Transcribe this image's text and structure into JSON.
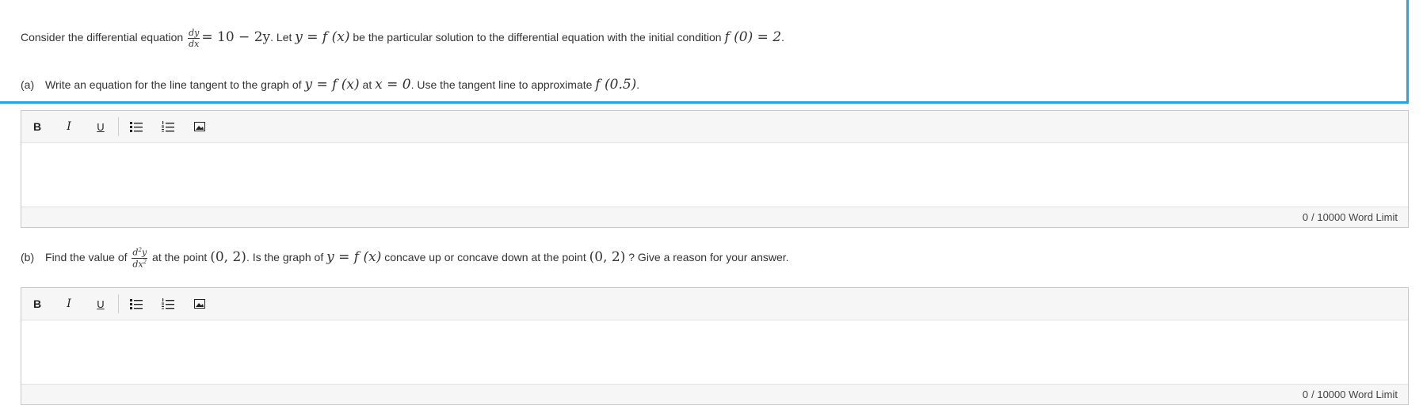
{
  "question": {
    "intro": {
      "text1": "Consider the differential equation",
      "frac_num": "dy",
      "frac_den": "dx",
      "eq": "= 10 − 2y",
      "text2": ". Let",
      "y_eq_f": "y = f (x)",
      "text3": "be the particular solution to the differential equation with the initial condition",
      "initial": "f (0) = 2",
      "text4": "."
    },
    "part_a": {
      "label": "(a)",
      "text1": "Write an equation for the line tangent to the graph of",
      "y_eq_f": "y = f (x)",
      "text2": "at",
      "x_eq": "x = 0",
      "text3": ". Use the tangent line to approximate",
      "approx": "f (0.5)",
      "text4": "."
    },
    "part_b": {
      "label": "(b)",
      "text1": "Find the value of",
      "frac_num_base": "d",
      "frac_num_sup": "2",
      "frac_num_tail": "y",
      "frac_den_base": "dx",
      "frac_den_sup": "2",
      "text2": "at the point",
      "point1": "(0, 2)",
      "text3": ". Is the graph of",
      "y_eq_f": "y = f (x)",
      "text4": "concave up or concave down at the point",
      "point2": "(0, 2)",
      "text5": "? Give a reason for your answer."
    }
  },
  "editor_toolbar": {
    "bold_label": "B",
    "italic_label": "I",
    "underline_label": "U",
    "icons": [
      "bold-icon",
      "italic-icon",
      "underline-icon",
      "bulleted-list-icon",
      "numbered-list-icon",
      "insert-image-icon"
    ]
  },
  "editor_a": {
    "word_count": "0",
    "limit_text": "/ 10000 Word Limit"
  },
  "editor_b": {
    "word_count": "0",
    "limit_text": "/ 10000 Word Limit"
  },
  "colors": {
    "focus_border": "#29a3e0",
    "toolbar_bg": "#f6f6f6"
  }
}
